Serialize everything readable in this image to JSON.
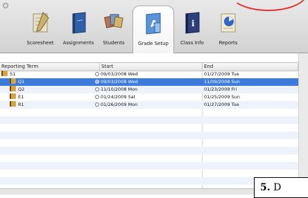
{
  "toolbar": {
    "items": [
      {
        "label": "Scoresheet",
        "icon": "scoresheet-icon"
      },
      {
        "label": "Assignments",
        "icon": "assignments-icon"
      },
      {
        "label": "Students",
        "icon": "students-icon"
      },
      {
        "label": "Grade Setup",
        "icon": "grade-setup-icon",
        "active": true
      },
      {
        "label": "Class Info",
        "icon": "class-info-icon"
      },
      {
        "label": "Reports",
        "icon": "reports-icon"
      }
    ]
  },
  "table": {
    "columns": [
      "Reporting Term",
      "Start",
      "End"
    ],
    "rows": [
      {
        "term": "S1",
        "start": "09/03/2008 Wed",
        "end": "01/27/2009 Tue",
        "level": 0,
        "selected": false
      },
      {
        "term": "Q1",
        "start": "09/03/2008 Wed",
        "end": "11/09/2008 Sun",
        "level": 1,
        "selected": true
      },
      {
        "term": "Q2",
        "start": "11/10/2008 Mon",
        "end": "01/23/2009 Fri",
        "level": 1,
        "selected": false
      },
      {
        "term": "E1",
        "start": "01/24/2009 Sat",
        "end": "01/25/2009 Sun",
        "level": 1,
        "selected": false
      },
      {
        "term": "R1",
        "start": "01/26/2009 Mon",
        "end": "01/27/2009 Tue",
        "level": 1,
        "selected": false
      }
    ]
  },
  "callout": {
    "number": "5.",
    "text": "D"
  },
  "colors": {
    "selection": "#3d7bdb",
    "folder": "#d9a23c",
    "stripe": "#eef3fb"
  }
}
